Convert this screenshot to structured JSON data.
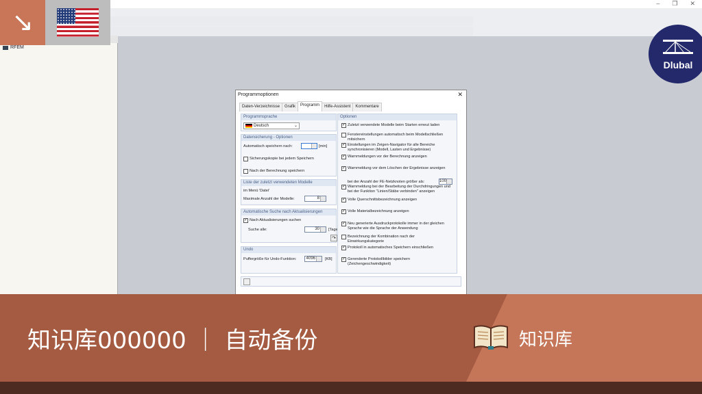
{
  "window": {
    "controls": [
      "–",
      "❐",
      "✕"
    ]
  },
  "sidebar": {
    "root": "RFEM"
  },
  "logo": {
    "text": "Dlubal"
  },
  "dialog": {
    "title": "Programmoptionen",
    "close": "✕",
    "tabs": [
      "Daten-Verzeichnisse",
      "Grafik",
      "Programm",
      "Hilfe-Assistent",
      "Kommentare"
    ],
    "active_tab": "Programm",
    "language": {
      "header": "Programmsprache",
      "value": "Deutsch"
    },
    "backup": {
      "header": "Datensicherung - Optionen",
      "autosave_label": "Automatisch speichern nach:",
      "autosave_value": "",
      "autosave_unit": "[min]",
      "backup_copy": "Sicherungskopie bei jedem Speichern",
      "backup_copy_checked": false,
      "after_calc": "Nach der Berechnung speichern",
      "after_calc_checked": false
    },
    "recent": {
      "header": "Liste der zuletzt verwendeten Modelle",
      "menu_note": "im Menü 'Datei'",
      "max_label": "Maximale Anzahl der Modelle:",
      "max_value": "8"
    },
    "updates": {
      "header": "Automatische Suche nach Aktualisierungen",
      "search": "Nach Aktualisierungen suchen",
      "search_checked": true,
      "interval_label": "Suche alle:",
      "interval_value": "30",
      "interval_unit": "[Tage]"
    },
    "undo": {
      "header": "Undo",
      "buffer_label": "Puffergröße für Undo-Funktion:",
      "buffer_value": "4096",
      "buffer_unit": "[KB]"
    },
    "options": {
      "header": "Optionen",
      "items": [
        {
          "label": "Zuletzt verwendete Modelle beim Starten erneut laden",
          "checked": true
        },
        {
          "label": "Fenstereinstellungen automatisch beim Modellschließen mitsichern",
          "checked": false
        },
        {
          "label": "Einstellungen im Zeigen-Navigator für alle Bereiche synchronisieren (Modell, Lasten und Ergebnisse)",
          "checked": true
        },
        {
          "label": "Warnmeldungen vor der Berechnung anzeigen",
          "checked": true
        },
        {
          "label": "Warnmeldung vor dem Löschen der Ergebnisse anzeigen",
          "checked": true
        },
        {
          "label": "Warnmeldung bei der Bearbeitung der Durchdringungen und bei der Funktion \"Linien/Stäbe verbinden\" anzeigen",
          "checked": true
        },
        {
          "label": "Volle Querschnittsbezeichnung anzeigen",
          "checked": true
        },
        {
          "label": "Volle Materialbezeichnung anzeigen",
          "checked": true
        },
        {
          "label": "Neu generierte Ausdruckprotokolle immer in der gleichen Sprache wie die Sprache der Anwendung",
          "checked": true
        },
        {
          "label": "Bezeichnung der Kombination nach der Einwirkungskategorie",
          "checked": false
        },
        {
          "label": "Protokoll in automatisches Speichern einschließen",
          "checked": true
        },
        {
          "label": "Gerenderte Protokollbilder speichern (Zeichengeschwindigkeit)",
          "checked": true
        }
      ],
      "fe_nodes_label": "bei der Anzahl der FE-Netzknoten größer als:",
      "fe_nodes_value": "100"
    }
  },
  "banner": {
    "title": "知识库000000 ｜ 自动备份",
    "category": "知识库"
  }
}
